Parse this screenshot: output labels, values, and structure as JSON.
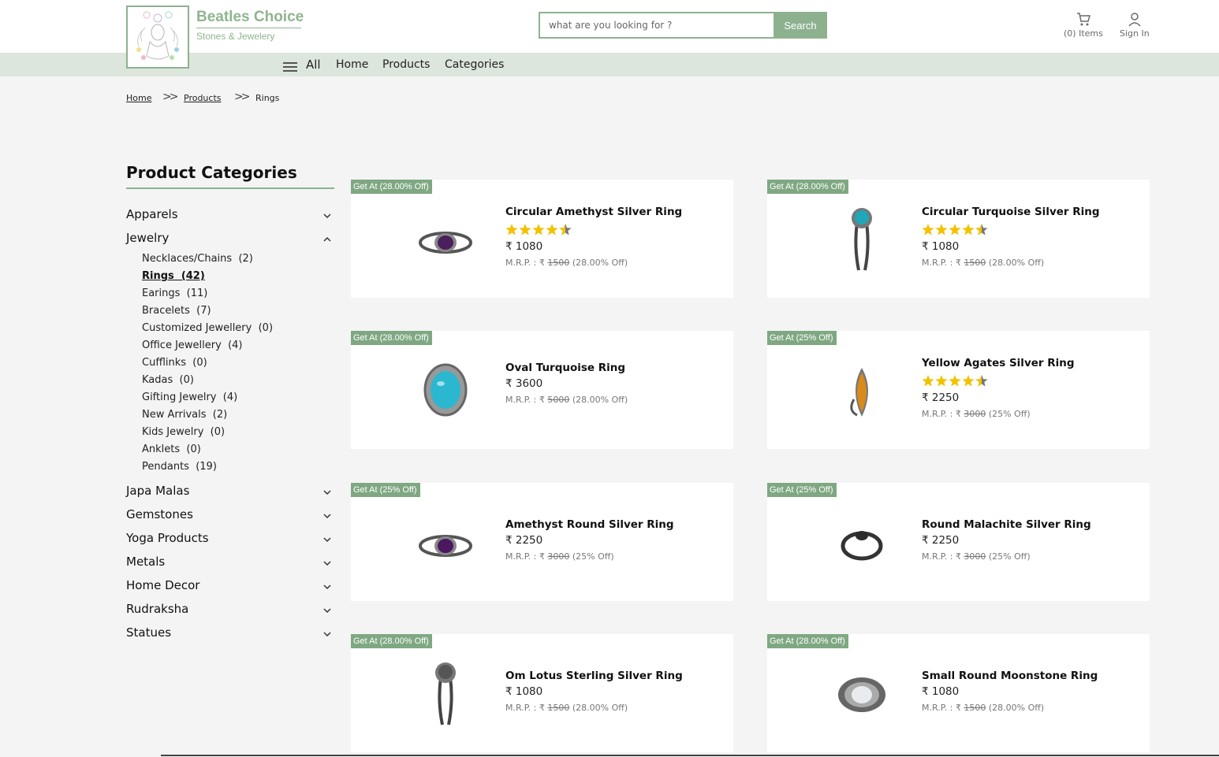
{
  "brand": {
    "title": "Beatles Choice",
    "subtitle": "Stones & Jewelery"
  },
  "search": {
    "placeholder": "what are you looking for ?",
    "button": "Search"
  },
  "header": {
    "cart_label": "(0) Items",
    "signin_label": "Sign In"
  },
  "nav": {
    "all": "All",
    "home": "Home",
    "products": "Products",
    "categories": "Categories"
  },
  "breadcrumb": {
    "home": "Home",
    "products": "Products",
    "current": "Rings",
    "sep": ">>"
  },
  "sidebar": {
    "title": "Product Categories",
    "categories": [
      "Apparels",
      "Jewelry",
      "Japa Malas",
      "Gemstones",
      "Yoga Products",
      "Metals",
      "Home Decor",
      "Rudraksha",
      "Statues"
    ],
    "jewelry_sub": [
      "Necklaces/Chains  (2)",
      "Rings  (42)",
      "Earings  (11)",
      "Bracelets  (7)",
      "Customized Jewellery  (0)",
      "Office Jewellery  (4)",
      "Cufflinks  (0)",
      "Kadas  (0)",
      "Gifting Jewelry  (4)",
      "New Arrivals  (2)",
      "Kids Jewelry  (0)",
      "Anklets  (0)",
      "Pendants  (19)"
    ]
  },
  "products": [
    {
      "badge": "Get At (28.00% Off)",
      "name": "Circular Amethyst Silver Ring",
      "rating": 4.5,
      "price": "₹ 1080",
      "mrp_prefix": "M.R.P. : ₹ ",
      "mrp": "1500",
      "off": " (28.00% Off)",
      "stone": "#4a1f5c"
    },
    {
      "badge": "Get At (28.00% Off)",
      "name": "Circular Turquoise Silver Ring",
      "rating": 4.5,
      "price": "₹ 1080",
      "mrp_prefix": "M.R.P. : ₹ ",
      "mrp": "1500",
      "off": " (28.00% Off)",
      "stone": "#1fa6b8"
    },
    {
      "badge": "Get At (28.00% Off)",
      "name": "Oval Turquoise Ring",
      "rating": null,
      "price": "₹ 3600",
      "mrp_prefix": "M.R.P. : ₹ ",
      "mrp": "5000",
      "off": " (28.00% Off)",
      "stone": "#2bb7cf"
    },
    {
      "badge": "Get At (25% Off)",
      "name": "Yellow Agates Silver Ring",
      "rating": 4.5,
      "price": "₹ 2250",
      "mrp_prefix": "M.R.P. : ₹ ",
      "mrp": "3000",
      "off": " (25% Off)",
      "stone": "#d98a1c"
    },
    {
      "badge": "Get At (25% Off)",
      "name": "Amethyst Round Silver Ring",
      "rating": null,
      "price": "₹ 2250",
      "mrp_prefix": "M.R.P. : ₹ ",
      "mrp": "3000",
      "off": " (25% Off)",
      "stone": "#4b1760"
    },
    {
      "badge": "Get At (25% Off)",
      "name": "Round Malachite Silver Ring",
      "rating": null,
      "price": "₹ 2250",
      "mrp_prefix": "M.R.P. : ₹ ",
      "mrp": "3000",
      "off": " (25% Off)",
      "stone": "#2b2b2b"
    },
    {
      "badge": "Get At (28.00% Off)",
      "name": "Om Lotus Sterling Silver Ring",
      "rating": null,
      "price": "₹ 1080",
      "mrp_prefix": "M.R.P. : ₹ ",
      "mrp": "1500",
      "off": " (28.00% Off)",
      "stone": "#555555"
    },
    {
      "badge": "Get At (28.00% Off)",
      "name": "Small Round Moonstone Ring",
      "rating": null,
      "price": "₹ 1080",
      "mrp_prefix": "M.R.P. : ₹ ",
      "mrp": "1500",
      "off": " (28.00% Off)",
      "stone": "#e8ecef"
    }
  ],
  "colors": {
    "accent": "#8db18f",
    "badge": "#7fa882",
    "star": "#f2c200",
    "navbar": "#dce6dc"
  }
}
